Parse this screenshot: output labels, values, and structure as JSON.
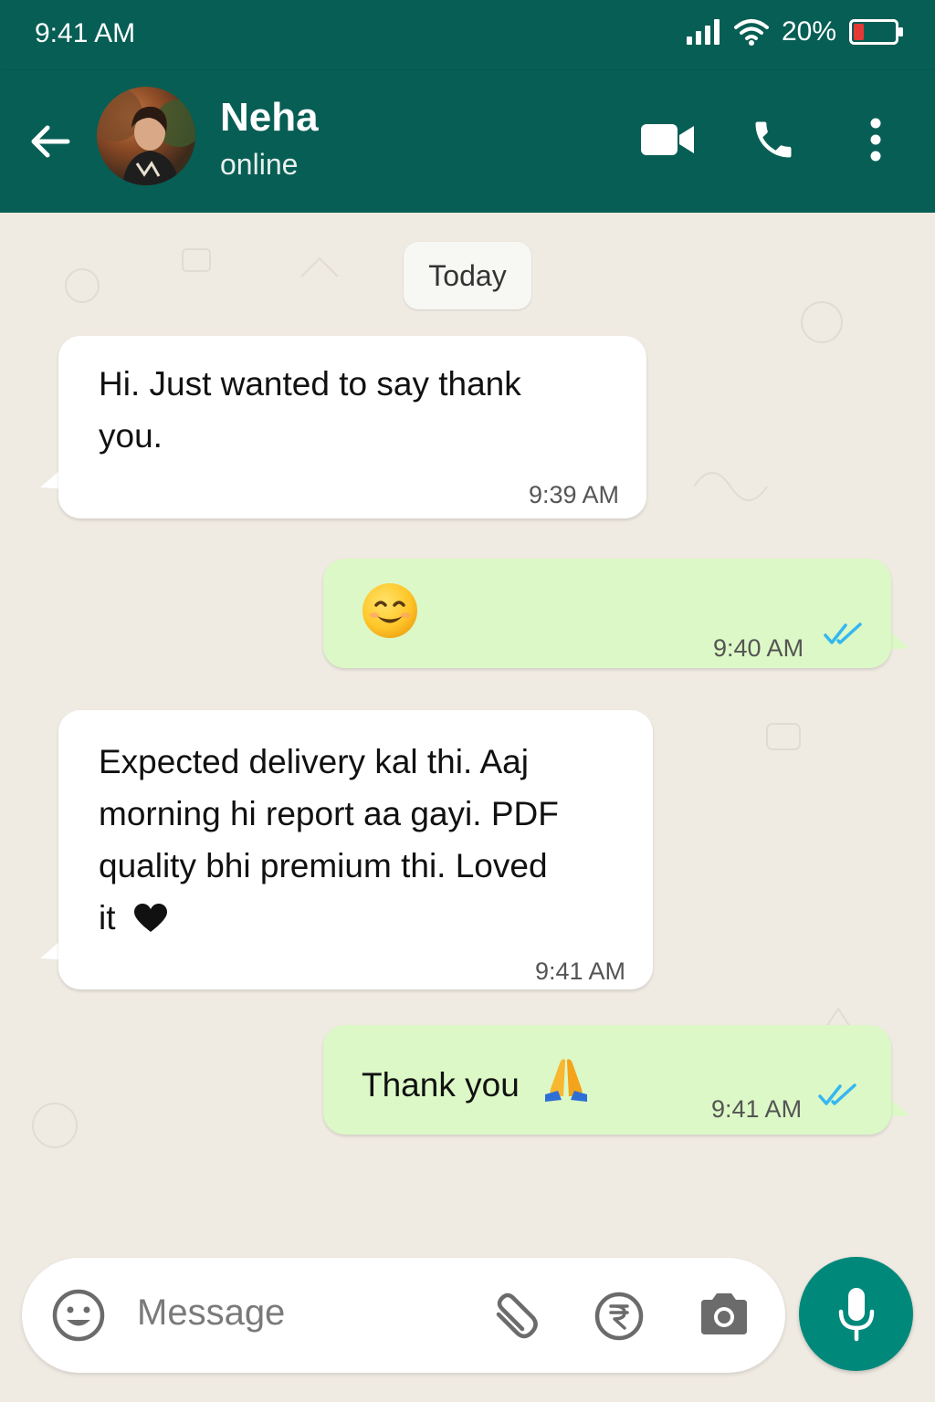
{
  "status_bar": {
    "time": "9:41 AM",
    "battery": "20%",
    "icons": [
      "signal-icon",
      "wifi-icon",
      "battery-icon"
    ]
  },
  "header": {
    "contact_name": "Neha",
    "contact_status": "online",
    "icons": [
      "back-arrow-icon",
      "video-call-icon",
      "phone-icon",
      "more-vertical-icon"
    ]
  },
  "chat": {
    "date_label": "Today",
    "messages": [
      {
        "direction": "incoming",
        "text_line1": "Hi. Just wanted to say thank",
        "text_line2": "you.",
        "time": "9:39 AM"
      },
      {
        "direction": "outgoing",
        "emoji": "smiling-face-emoji",
        "time": "9:40 AM",
        "status": "read"
      },
      {
        "direction": "incoming",
        "text_line1": "Expected delivery kal thi. Aaj",
        "text_line2": "morning hi report aa gayi. PDF",
        "text_line3": "quality bhi premium thi. Loved",
        "text_line4": "it",
        "emoji": "black-heart-emoji",
        "time": "9:41 AM"
      },
      {
        "direction": "outgoing",
        "text_line1": "Thank you",
        "emoji": "folded-hands-emoji",
        "time": "9:41 AM",
        "status": "read"
      }
    ]
  },
  "composer": {
    "placeholder": "Message",
    "icons": [
      "emoji-icon",
      "attach-icon",
      "rupee-payment-icon",
      "camera-icon",
      "mic-icon"
    ]
  },
  "colors": {
    "header": "#075e54",
    "outgoing_bubble": "#dcf8c6",
    "incoming_bubble": "#ffffff",
    "chat_background": "#efeae2",
    "read_ticks": "#34b7f1",
    "mic_button": "#00897b"
  }
}
